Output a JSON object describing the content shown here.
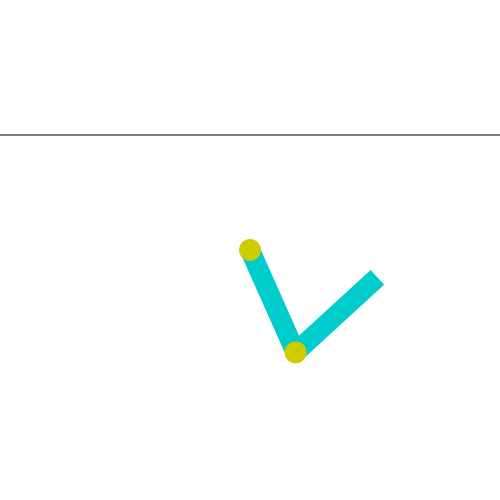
{
  "environment": {
    "name": "acrobot",
    "background_color": "#ffffff",
    "goal_line_color": "#000000",
    "link_color": "#00cccc",
    "joint_color": "#cccc00"
  },
  "state": {
    "link1_angle_deg": 155,
    "link2_angle_deg": -135
  }
}
